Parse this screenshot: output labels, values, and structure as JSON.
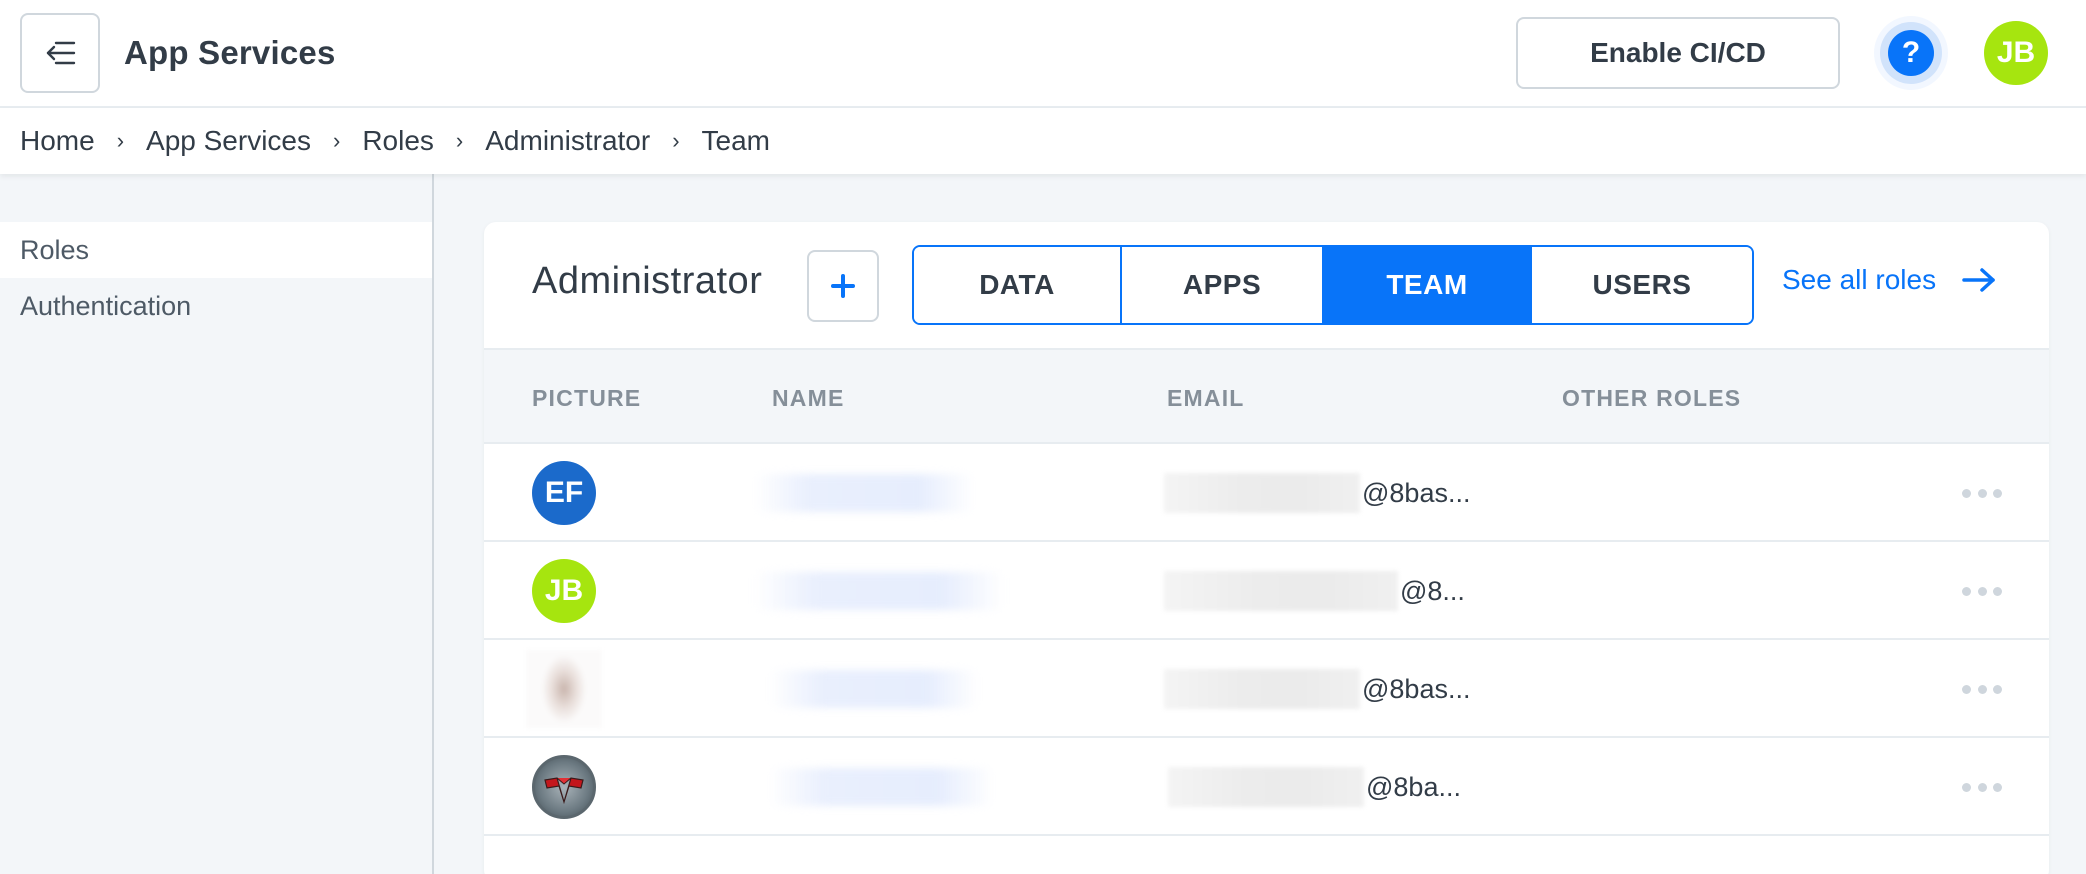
{
  "header": {
    "title": "App Services",
    "menu_icon": "collapse-menu-icon",
    "cicd_button": "Enable CI/CD",
    "help_icon": "question-icon",
    "help_label": "?",
    "user_initials": "JB",
    "user_avatar_color": "#a6e50f"
  },
  "breadcrumbs": [
    {
      "label": "Home"
    },
    {
      "label": "App Services"
    },
    {
      "label": "Roles"
    },
    {
      "label": "Administrator"
    },
    {
      "label": "Team"
    }
  ],
  "breadcrumb_separator": "›",
  "sidebar": {
    "items": [
      {
        "label": "Roles",
        "active": true
      },
      {
        "label": "Authentication",
        "active": false
      }
    ]
  },
  "role": {
    "title": "Administrator",
    "add_icon": "plus-icon",
    "tabs": [
      {
        "label": "DATA",
        "active": false
      },
      {
        "label": "APPS",
        "active": false
      },
      {
        "label": "TEAM",
        "active": true
      },
      {
        "label": "USERS",
        "active": false
      }
    ],
    "see_all_label": "See all roles",
    "see_all_icon": "arrow-right-icon"
  },
  "table": {
    "columns": [
      "PICTURE",
      "NAME",
      "EMAIL",
      "OTHER ROLES"
    ],
    "rows": [
      {
        "avatar_type": "initials",
        "initials": "EF",
        "avatar_color": "#1b6acb",
        "name": "[redacted]",
        "email_domain": "@8bas...",
        "other_roles": ""
      },
      {
        "avatar_type": "initials",
        "initials": "JB",
        "avatar_color": "#a6e50f",
        "name": "[redacted]",
        "email_domain": "@8...",
        "other_roles": ""
      },
      {
        "avatar_type": "photo",
        "initials": "",
        "avatar_color": "",
        "name": "[redacted]",
        "email_domain": "@8bas...",
        "other_roles": ""
      },
      {
        "avatar_type": "badge",
        "initials": "",
        "avatar_color": "",
        "name": "[redacted]",
        "email_domain": "@8ba...",
        "other_roles": ""
      }
    ],
    "row_menu_icon": "more-horizontal-icon"
  },
  "colors": {
    "accent": "#0874f9",
    "text": "#323c47",
    "muted": "#858f99",
    "border": "#d0d7dd",
    "background": "#f3f6f9"
  }
}
